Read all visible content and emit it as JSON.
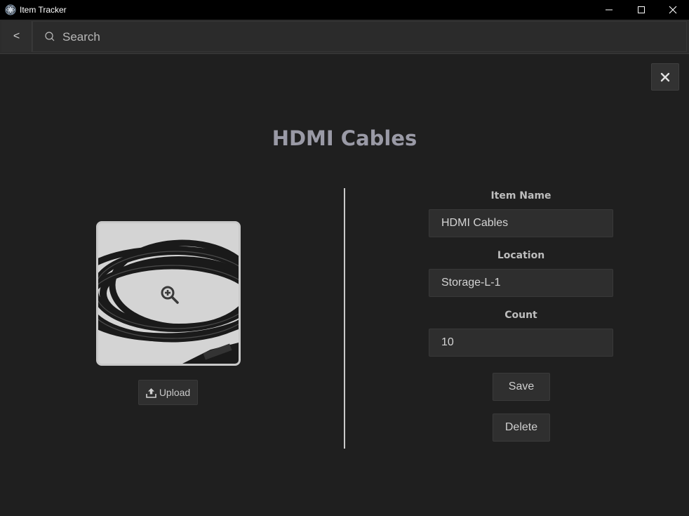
{
  "window": {
    "title": "Item Tracker"
  },
  "toolbar": {
    "back_label": "<",
    "search_placeholder": "Search"
  },
  "detail": {
    "title": "HDMI Cables",
    "upload_label": "Upload",
    "fields": {
      "name_label": "Item Name",
      "name_value": "HDMI Cables",
      "location_label": "Location",
      "location_value": "Storage-L-1",
      "count_label": "Count",
      "count_value": "10"
    },
    "save_label": "Save",
    "delete_label": "Delete"
  },
  "icons": {
    "app": "app-logo-icon",
    "minimize": "minimize-icon",
    "maximize": "maximize-icon",
    "close_window": "close-icon",
    "search": "search-icon",
    "close_panel": "close-icon",
    "zoom": "zoom-in-icon",
    "upload": "upload-icon"
  },
  "colors": {
    "background": "#1f1f1f",
    "titlebar": "#000000",
    "title_text": "#9a9aa6",
    "input_bg": "#2e2e2e"
  }
}
